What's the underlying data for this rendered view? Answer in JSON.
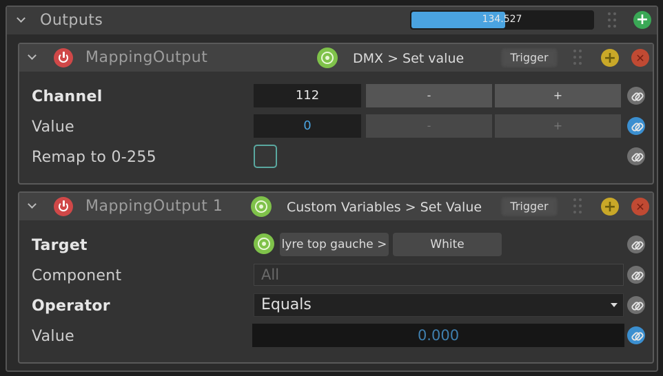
{
  "outputs": {
    "title": "Outputs",
    "progress_text": "134.527",
    "progress_fraction": 0.51
  },
  "mapping_output": {
    "title": "MappingOutput",
    "command": "DMX > Set value",
    "trigger_label": "Trigger",
    "params": {
      "channel_label": "Channel",
      "channel_value": "112",
      "value_label": "Value",
      "value_value": "0",
      "remap_label": "Remap to 0-255",
      "minus": "-",
      "plus": "+"
    }
  },
  "mapping_output_1": {
    "title": "MappingOutput 1",
    "command": "Custom Variables > Set Value",
    "trigger_label": "Trigger",
    "params": {
      "target_label": "Target",
      "target_group": "lyre top gauche >",
      "target_item": "White",
      "component_label": "Component",
      "component_placeholder": "All",
      "operator_label": "Operator",
      "operator_value": "Equals",
      "value_label": "Value",
      "value_value": "0.000"
    }
  },
  "icons": {
    "collapse": "chevron-down-icon",
    "power": "power-icon",
    "target": "target-icon",
    "grip": "drag-handle-icon",
    "add": "plus-icon",
    "remove": "close-icon",
    "link": "link-icon"
  },
  "colors": {
    "progress": "#4aa3e0",
    "power": "#d04848",
    "target": "#7fc24a",
    "add_outputs": "#3aa856",
    "add_item": "#c9a828",
    "remove_item": "#c04a33",
    "checkbox_border": "#5aa8a0",
    "link_active": "#3b8fd0"
  }
}
